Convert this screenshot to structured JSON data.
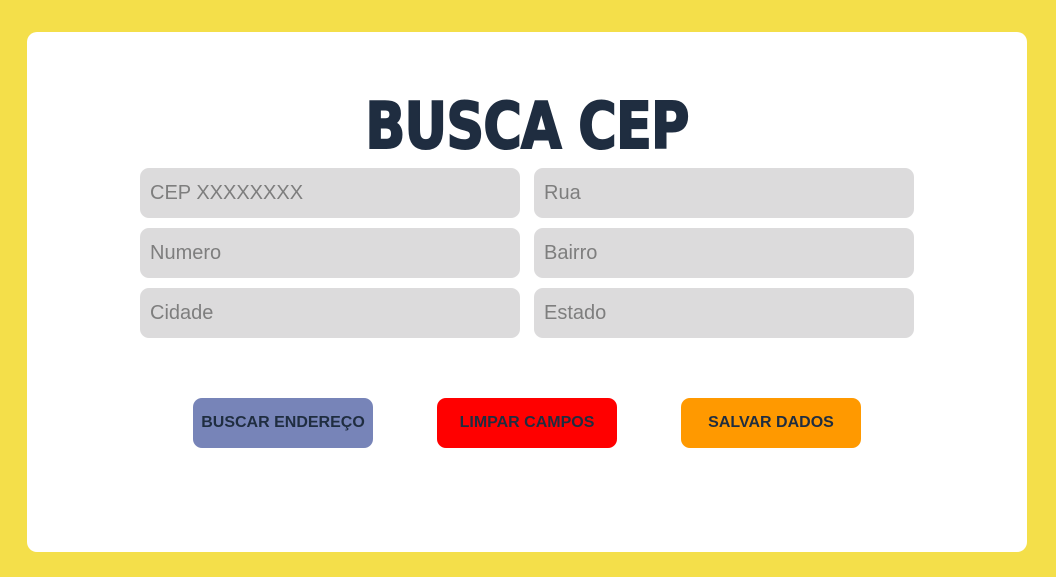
{
  "page": {
    "title": "BUSCA CEP",
    "colors": {
      "background": "#f4df4a",
      "card": "#ffffff",
      "field": "#dcdbdc",
      "title": "#1f2d40"
    }
  },
  "form": {
    "cep_placeholder": "CEP XXXXXXXX",
    "rua_placeholder": "Rua",
    "numero_placeholder": "Numero",
    "bairro_placeholder": "Bairro",
    "cidade_placeholder": "Cidade",
    "estado_placeholder": "Estado"
  },
  "buttons": {
    "search": {
      "label": "BUSCAR ENDEREÇO",
      "color": "#7784b8"
    },
    "clear": {
      "label": "LIMPAR CAMPOS",
      "color": "#ff0000"
    },
    "save": {
      "label": "SALVAR DADOS",
      "color": "#ff9900"
    }
  }
}
